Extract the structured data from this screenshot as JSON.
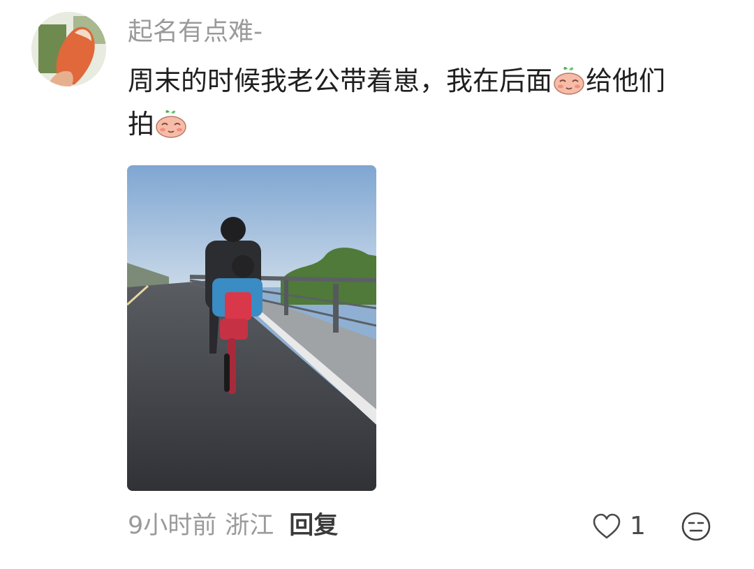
{
  "comment": {
    "username": "起名有点难-",
    "text_line1_part1": "周末的时候我老公带着崽，我在后面",
    "text_line1_part2": "给他们",
    "text_line2": "拍",
    "emoji_icon": "shy-face-emoji",
    "photo_icon": "photo-man-and-child-cycling-on-bridge",
    "time": "9小时前",
    "location": "浙江",
    "reply_label": "回复",
    "like_count": "1",
    "like_icon": "heart-outline-icon",
    "reaction_icon": "neutral-face-icon"
  },
  "colors": {
    "username": "#9a9a9a",
    "text": "#1f1f1f",
    "meta": "#9a9a9a",
    "reply": "#3a3a3a",
    "background": "#ffffff"
  }
}
